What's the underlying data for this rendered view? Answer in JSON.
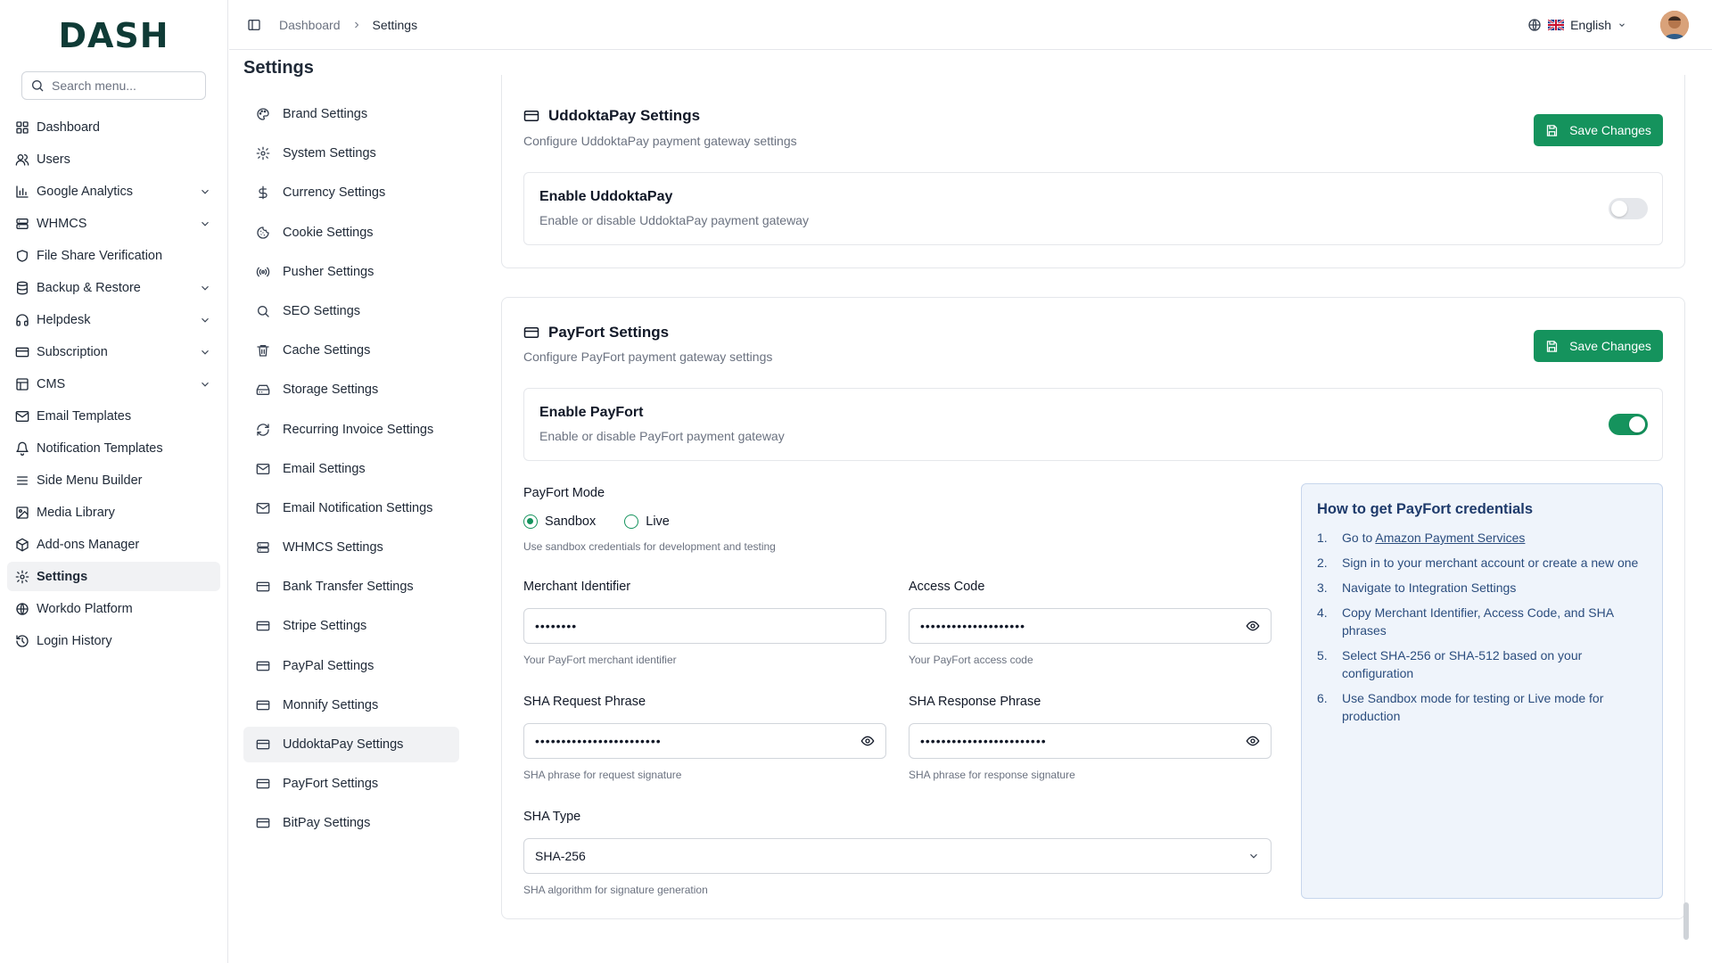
{
  "brand": {
    "logo": "DASH"
  },
  "sidebar": {
    "search_placeholder": "Search menu...",
    "items": [
      {
        "label": "Dashboard",
        "icon": "dashboard-icon"
      },
      {
        "label": "Users",
        "icon": "users-icon"
      },
      {
        "label": "Google Analytics",
        "icon": "chart-icon",
        "expandable": true
      },
      {
        "label": "WHMCS",
        "icon": "server-icon",
        "expandable": true
      },
      {
        "label": "File Share Verification",
        "icon": "shield-icon"
      },
      {
        "label": "Backup & Restore",
        "icon": "database-icon",
        "expandable": true
      },
      {
        "label": "Helpdesk",
        "icon": "headphones-icon",
        "expandable": true
      },
      {
        "label": "Subscription",
        "icon": "card-icon",
        "expandable": true
      },
      {
        "label": "CMS",
        "icon": "layout-icon",
        "expandable": true
      },
      {
        "label": "Email Templates",
        "icon": "mail-icon"
      },
      {
        "label": "Notification Templates",
        "icon": "bell-icon"
      },
      {
        "label": "Side Menu Builder",
        "icon": "menu-icon"
      },
      {
        "label": "Media Library",
        "icon": "image-icon"
      },
      {
        "label": "Add-ons Manager",
        "icon": "package-icon"
      },
      {
        "label": "Settings",
        "icon": "gear-icon",
        "active": true
      },
      {
        "label": "Workdo Platform",
        "icon": "globe-icon"
      },
      {
        "label": "Login History",
        "icon": "history-icon"
      }
    ]
  },
  "topbar": {
    "breadcrumb": [
      "Dashboard",
      "Settings"
    ],
    "language": "English"
  },
  "page": {
    "title": "Settings"
  },
  "settings_menu": [
    {
      "label": "Brand Settings",
      "icon": "palette-icon"
    },
    {
      "label": "System Settings",
      "icon": "gear-icon"
    },
    {
      "label": "Currency Settings",
      "icon": "dollar-icon"
    },
    {
      "label": "Cookie Settings",
      "icon": "cookie-icon"
    },
    {
      "label": "Pusher Settings",
      "icon": "broadcast-icon"
    },
    {
      "label": "SEO Settings",
      "icon": "search-icon"
    },
    {
      "label": "Cache Settings",
      "icon": "trash-icon"
    },
    {
      "label": "Storage Settings",
      "icon": "drive-icon"
    },
    {
      "label": "Recurring Invoice Settings",
      "icon": "refresh-icon"
    },
    {
      "label": "Email Settings",
      "icon": "mail-icon"
    },
    {
      "label": "Email Notification Settings",
      "icon": "mail-icon"
    },
    {
      "label": "WHMCS Settings",
      "icon": "server-icon"
    },
    {
      "label": "Bank Transfer Settings",
      "icon": "card-icon"
    },
    {
      "label": "Stripe Settings",
      "icon": "card-icon"
    },
    {
      "label": "PayPal Settings",
      "icon": "card-icon"
    },
    {
      "label": "Monnify Settings",
      "icon": "card-icon"
    },
    {
      "label": "UddoktaPay Settings",
      "icon": "card-icon",
      "active": true
    },
    {
      "label": "PayFort Settings",
      "icon": "card-icon"
    },
    {
      "label": "BitPay Settings",
      "icon": "card-icon"
    }
  ],
  "uddoktapay": {
    "title": "UddoktaPay Settings",
    "subtitle": "Configure UddoktaPay payment gateway settings",
    "save_label": "Save Changes",
    "enable_title": "Enable UddoktaPay",
    "enable_desc": "Enable or disable UddoktaPay payment gateway",
    "enabled": false
  },
  "payfort": {
    "title": "PayFort Settings",
    "subtitle": "Configure PayFort payment gateway settings",
    "save_label": "Save Changes",
    "enable_title": "Enable PayFort",
    "enable_desc": "Enable or disable PayFort payment gateway",
    "enabled": true,
    "mode_label": "PayFort Mode",
    "mode_options": [
      "Sandbox",
      "Live"
    ],
    "mode_selected": "Sandbox",
    "mode_hint": "Use sandbox credentials for development and testing",
    "merchant_label": "Merchant Identifier",
    "merchant_value": "••••••••",
    "merchant_hint": "Your PayFort merchant identifier",
    "access_label": "Access Code",
    "access_value": "••••••••••••••••••••",
    "access_hint": "Your PayFort access code",
    "sha_req_label": "SHA Request Phrase",
    "sha_req_value": "••••••••••••••••••••••••",
    "sha_req_hint": "SHA phrase for request signature",
    "sha_resp_label": "SHA Response Phrase",
    "sha_resp_value": "••••••••••••••••••••••••",
    "sha_resp_hint": "SHA phrase for response signature",
    "sha_type_label": "SHA Type",
    "sha_type_value": "SHA-256",
    "sha_type_hint": "SHA algorithm for signature generation"
  },
  "help": {
    "title": "How to get PayFort credentials",
    "steps": [
      {
        "n": "1.",
        "prefix": "Go to ",
        "link": "Amazon Payment Services"
      },
      {
        "n": "2.",
        "text": "Sign in to your merchant account or create a new one"
      },
      {
        "n": "3.",
        "text": "Navigate to Integration Settings"
      },
      {
        "n": "4.",
        "text": "Copy Merchant Identifier, Access Code, and SHA phrases"
      },
      {
        "n": "5.",
        "text": "Select SHA-256 or SHA-512 based on your configuration"
      },
      {
        "n": "6.",
        "text": "Use Sandbox mode for testing or Live mode for production"
      }
    ]
  },
  "colors": {
    "accent": "#15935d",
    "help_bg": "#eff4fb",
    "help_text": "#2b4d7e"
  }
}
